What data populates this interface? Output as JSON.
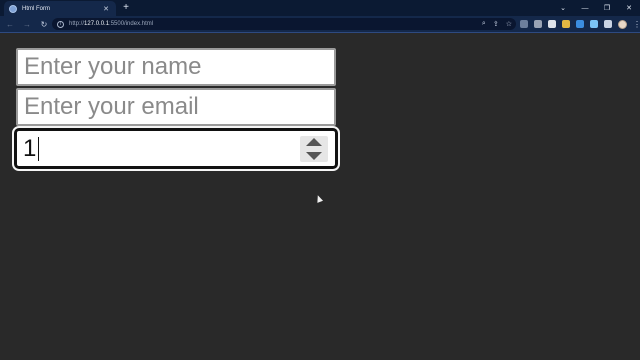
{
  "browser": {
    "tab_title": "Html Form",
    "tab_close": "✕",
    "new_tab": "+",
    "url_scheme": "http://",
    "url_host": "127.0.0.1",
    "url_rest": ":5500/index.html",
    "window_controls": [
      "⌄",
      "—",
      "❐",
      "✕"
    ],
    "nav": {
      "back": "←",
      "forward": "→",
      "reload": "↻"
    },
    "omnibox_icons": [
      "⌕",
      "⇪",
      "☆"
    ],
    "extension_colors": [
      "#6d7f9c",
      "#9aa4b5",
      "#dfe3ea",
      "#e2b843",
      "#3b8de0",
      "#7cc4f5",
      "#c9d3e3"
    ],
    "kebab": "⋮"
  },
  "form": {
    "name_placeholder": "Enter your name",
    "email_placeholder": "Enter your email",
    "number_value": "1"
  },
  "colors": {
    "page_bg": "#292929",
    "titlebar_bg": "#0b1a33",
    "toolbar_bg": "#14284a"
  }
}
